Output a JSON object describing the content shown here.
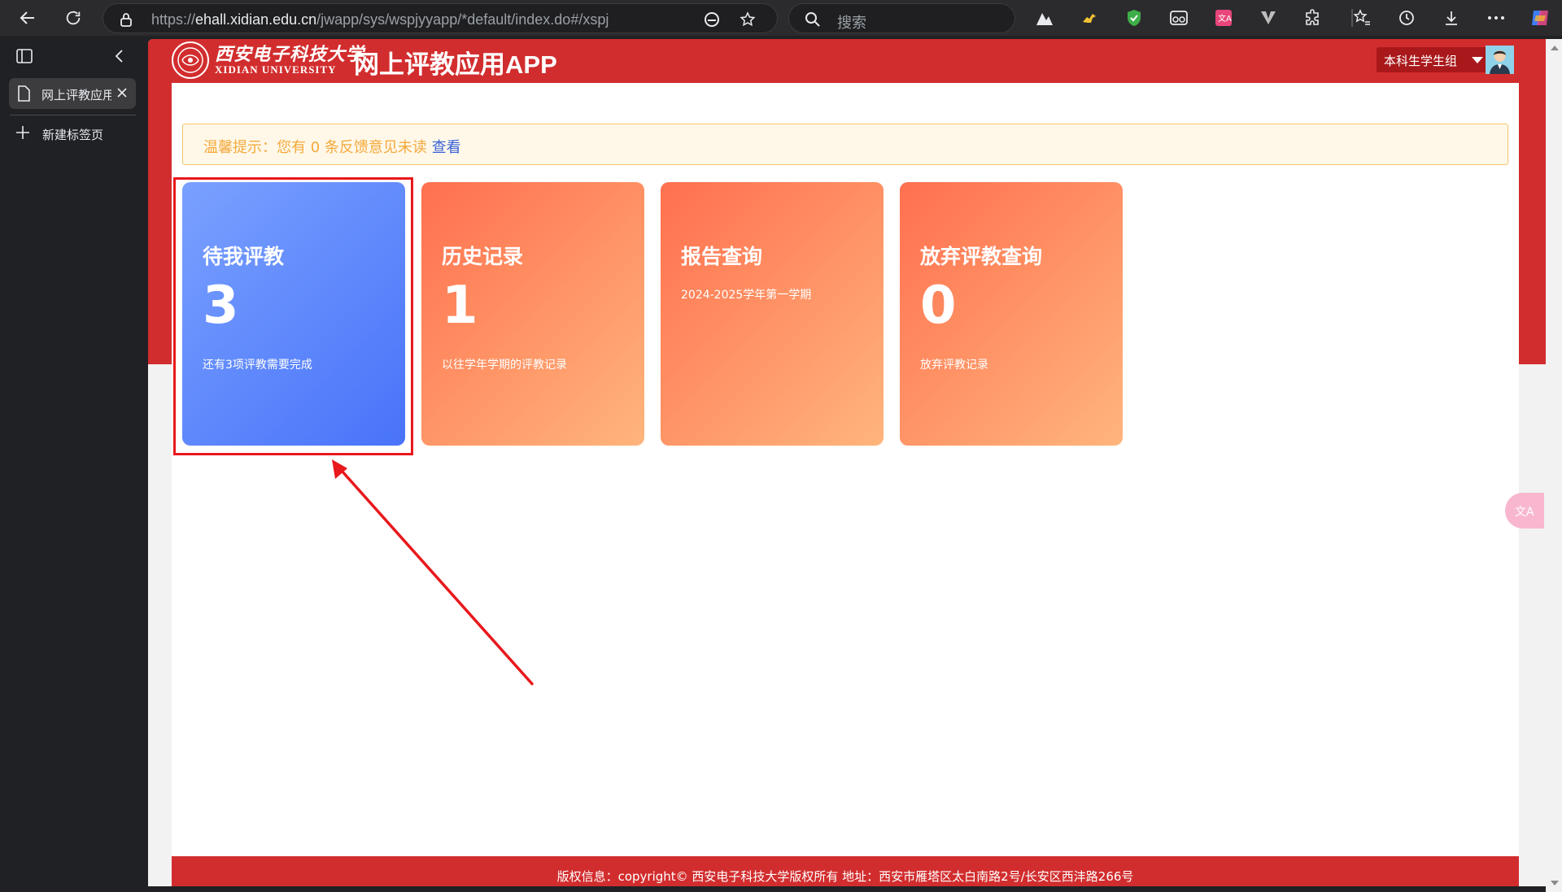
{
  "browser": {
    "url_prefix": "https://",
    "url_host": "ehall.xidian.edu.cn",
    "url_path": "/jwapp/sys/wspjyyapp/*default/index.do#/xspj",
    "search_placeholder": "搜索"
  },
  "sidebar": {
    "active_tab_label": "网上评教应用APP",
    "new_tab_label": "新建标签页"
  },
  "header": {
    "logo_cn": "西安电子科技大学",
    "logo_en": "XIDIAN UNIVERSITY",
    "title": "网上评教应用APP",
    "role": "本科生学生组"
  },
  "notice": {
    "text": "温馨提示：您有 0 条反馈意见未读 ",
    "link": "查看"
  },
  "cards": [
    {
      "title": "待我评教",
      "value": "3",
      "desc": "还有3项评教需要完成",
      "style": "blue"
    },
    {
      "title": "历史记录",
      "value": "1",
      "desc": "以往学年学期的评教记录",
      "style": "orange"
    },
    {
      "title": "报告查询",
      "sub": "2024-2025学年第一学期",
      "style": "orange"
    },
    {
      "title": "放弃评教查询",
      "value": "0",
      "desc": "放弃评教记录",
      "style": "orange"
    }
  ],
  "footer": {
    "text": "版权信息：copyright© 西安电子科技大学版权所有 地址：西安市雁塔区太白南路2号/长安区西沣路266号"
  },
  "colors": {
    "brand_red": "#d22d2e",
    "card_blue": "#4873f9",
    "card_orange": "#ff8a5c",
    "annotation_red": "#e8181c"
  }
}
